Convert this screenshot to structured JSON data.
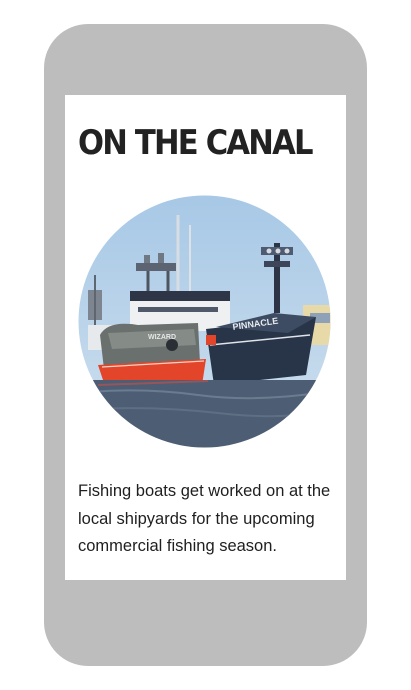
{
  "article": {
    "title": "ON THE CANAL",
    "caption": "Fishing boats get worked on at the local shipyards for the upcoming commercial fishing season.",
    "illustration": {
      "boat_left_name": "WIZARD",
      "boat_right_name": "PINNACLE"
    }
  },
  "colors": {
    "device_frame": "#bdbdbd",
    "screen_bg": "#ffffff",
    "title_text": "#222222",
    "sky": "#aecde8",
    "water": "#4d5d73",
    "hull_red": "#e2452a",
    "hull_navy": "#283448"
  }
}
